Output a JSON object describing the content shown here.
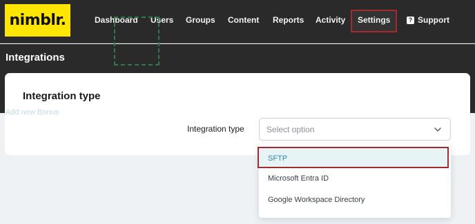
{
  "brand": {
    "logo_text": "nimblr.",
    "logo_color": "#ffe600"
  },
  "nav": {
    "items": [
      {
        "label": "Dashboard"
      },
      {
        "label": "Users"
      },
      {
        "label": "Groups"
      },
      {
        "label": "Content"
      },
      {
        "label": "Reports"
      },
      {
        "label": "Activity"
      },
      {
        "label": "Settings",
        "active": true
      },
      {
        "label": "Support",
        "icon": "help-icon"
      }
    ],
    "help_icon_glyph": "?"
  },
  "page": {
    "title": "Integrations"
  },
  "card": {
    "title": "Integration type",
    "ghost_text": "Add new Bonus"
  },
  "form": {
    "label": "Integration type",
    "select_placeholder": "Select option",
    "options": [
      {
        "label": "SFTP",
        "selected": true
      },
      {
        "label": "Microsoft Entra ID"
      },
      {
        "label": "Google Workspace Directory"
      }
    ]
  },
  "colors": {
    "topbar_bg": "#2a2a2a",
    "highlight_border": "#a8292d",
    "selected_option_text": "#2a88b0",
    "selected_option_bg": "#e8f3f6"
  }
}
